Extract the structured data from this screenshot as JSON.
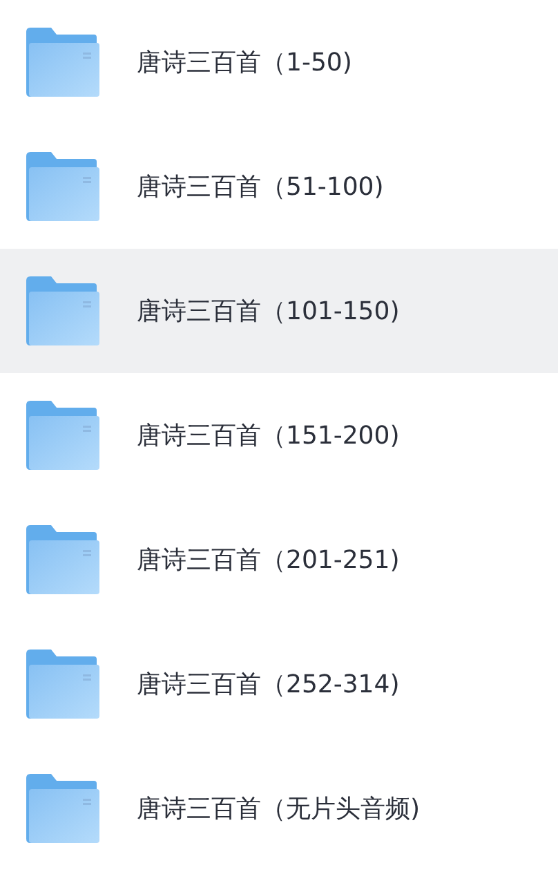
{
  "folders": [
    {
      "name": "唐诗三百首（1-50)",
      "selected": false
    },
    {
      "name": "唐诗三百首（51-100)",
      "selected": false
    },
    {
      "name": "唐诗三百首（101-150)",
      "selected": true
    },
    {
      "name": "唐诗三百首（151-200)",
      "selected": false
    },
    {
      "name": "唐诗三百首（201-251)",
      "selected": false
    },
    {
      "name": "唐诗三百首（252-314)",
      "selected": false
    },
    {
      "name": "唐诗三百首（无片头音频)",
      "selected": false
    }
  ]
}
